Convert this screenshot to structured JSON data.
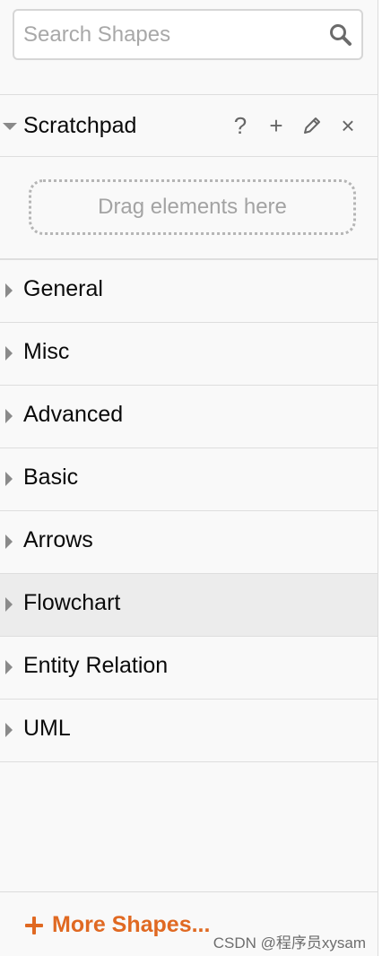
{
  "search": {
    "placeholder": "Search Shapes",
    "icon": "search-icon"
  },
  "scratchpad": {
    "title": "Scratchpad",
    "tools": [
      {
        "name": "help",
        "glyph": "?"
      },
      {
        "name": "add",
        "glyph": "+"
      },
      {
        "name": "edit",
        "glyph": "pencil"
      },
      {
        "name": "close",
        "glyph": "×"
      }
    ],
    "drop_hint": "Drag elements here"
  },
  "categories": [
    {
      "label": "General",
      "selected": false
    },
    {
      "label": "Misc",
      "selected": false
    },
    {
      "label": "Advanced",
      "selected": false
    },
    {
      "label": "Basic",
      "selected": false
    },
    {
      "label": "Arrows",
      "selected": false
    },
    {
      "label": "Flowchart",
      "selected": true
    },
    {
      "label": "Entity Relation",
      "selected": false
    },
    {
      "label": "UML",
      "selected": false
    }
  ],
  "footer": {
    "more_shapes_label": "More Shapes...",
    "watermark": "CSDN @程序员xysam"
  },
  "colors": {
    "accent": "#e06922",
    "selected_row": "#ececec"
  }
}
